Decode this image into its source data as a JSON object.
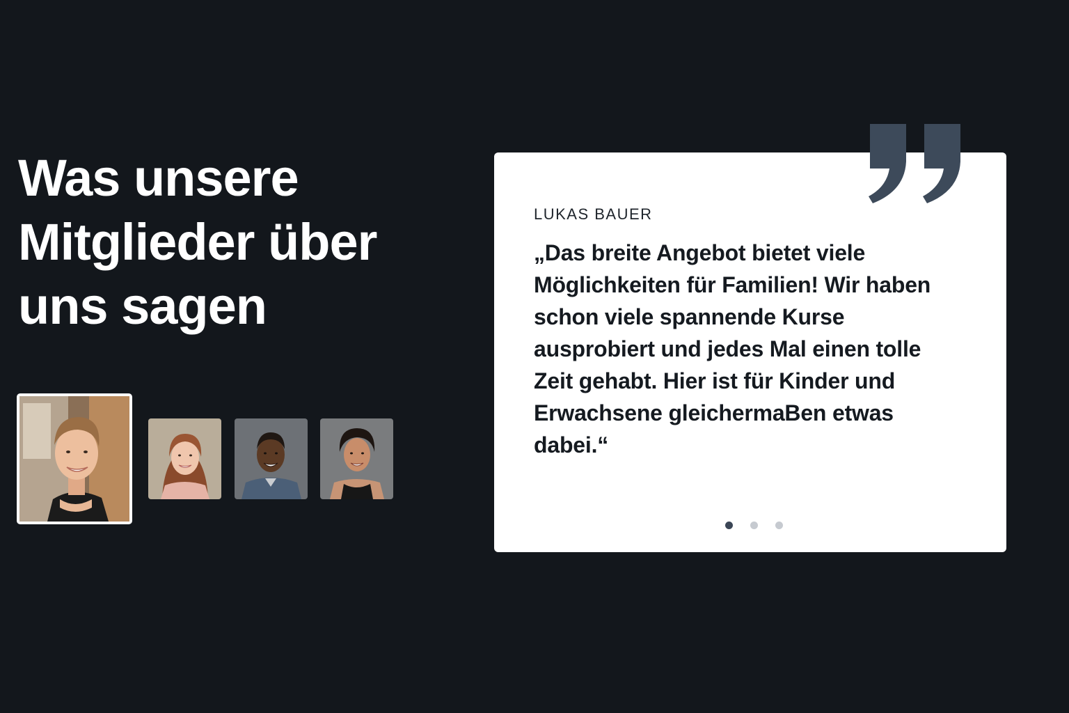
{
  "section": {
    "heading_lines": [
      "Was unsere",
      "Mitglieder über",
      "uns sagen"
    ]
  },
  "members": [
    {
      "icon": "member-photo-man-smiling",
      "active": true
    },
    {
      "icon": "member-photo-woman-auburn-hair",
      "active": false
    },
    {
      "icon": "member-photo-man-dark-hair",
      "active": false
    },
    {
      "icon": "member-photo-woman-curly-hair",
      "active": false
    }
  ],
  "testimonial": {
    "author": "LUKAS BAUER",
    "quote": "„Das breite Angebot bietet viele Möglichkeiten für Familien! Wir haben schon viele spannende Kurse ausprobiert und jedes Mal einen tolle Zeit gehabt. Hier ist für Kinder und Erwachsene gleichermaBen etwas dabei.“",
    "quote_icon": "quotation-mark-icon"
  },
  "pagination": {
    "count": 3,
    "active_index": 0
  },
  "colors": {
    "background": "#13171c",
    "card": "#ffffff",
    "quote_mark": "#3d4a5a",
    "dot_active": "#3b4656",
    "dot_inactive": "#c6cad0"
  }
}
